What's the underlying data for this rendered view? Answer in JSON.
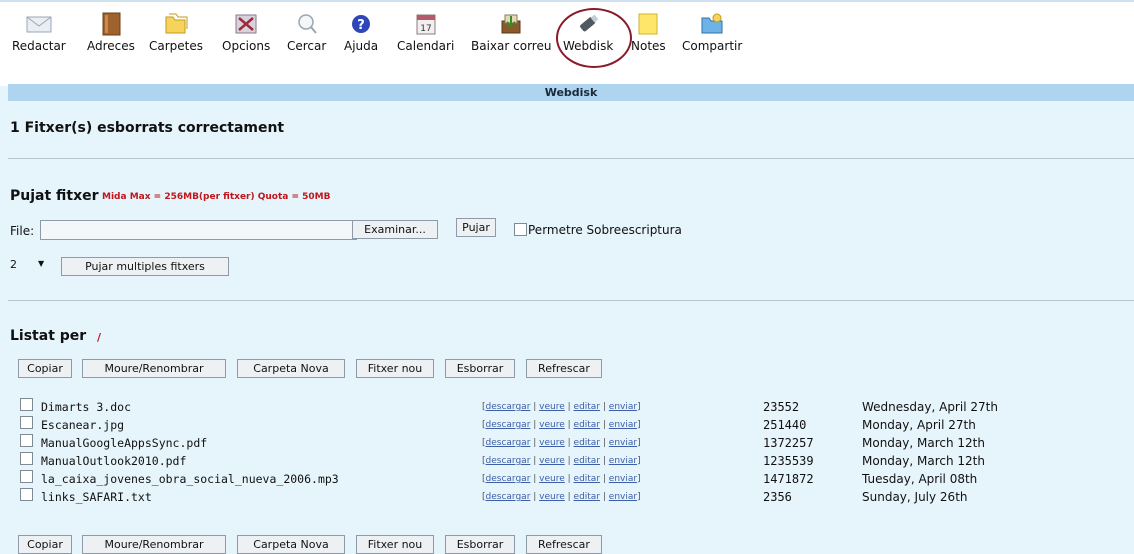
{
  "toolbar": {
    "items": [
      {
        "label": "Redactar",
        "icon": "envelope-icon"
      },
      {
        "label": "Adreces",
        "icon": "address-book-icon"
      },
      {
        "label": "Carpetes",
        "icon": "folders-icon"
      },
      {
        "label": "Opcions",
        "icon": "options-icon"
      },
      {
        "label": "Cercar",
        "icon": "search-icon"
      },
      {
        "label": "Ajuda",
        "icon": "help-icon"
      },
      {
        "label": "Calendari",
        "icon": "calendar-icon"
      },
      {
        "label": "Baixar correu",
        "icon": "download-mail-icon"
      },
      {
        "label": "Webdisk",
        "icon": "usb-drive-icon"
      },
      {
        "label": "Notes",
        "icon": "note-icon"
      },
      {
        "label": "Compartir",
        "icon": "share-icon"
      }
    ],
    "calendar_day": "17"
  },
  "section_title": "Webdisk",
  "status_message": "1 Fitxer(s) esborrats correctament",
  "upload": {
    "title": "Pujat fitxer",
    "meta": "Mida Max = 256MB(per fitxer)   Quota = 50MB",
    "file_label": "File:",
    "file_value": "",
    "browse_label": "Examinar...",
    "upload_label": "Pujar",
    "overwrite_label": "Permetre Sobreescriptura",
    "multi_count": "2",
    "multi_label": "Pujar multiples fitxers"
  },
  "listing": {
    "title": "Listat per",
    "path": "/",
    "buttons": [
      "Copiar",
      "Moure/Renombrar",
      "Carpeta Nova",
      "Fitxer nou",
      "Esborrar",
      "Refrescar"
    ],
    "actions": [
      "descargar",
      "veure",
      "editar",
      "enviar"
    ],
    "files": [
      {
        "name": "Dimarts 3.doc",
        "size": "23552",
        "date": "Wednesday, April 27th"
      },
      {
        "name": "Escanear.jpg",
        "size": "251440",
        "date": "Monday, April 27th"
      },
      {
        "name": "ManualGoogleAppsSync.pdf",
        "size": "1372257",
        "date": "Monday, March 12th"
      },
      {
        "name": "ManualOutlook2010.pdf",
        "size": "1235539",
        "date": "Monday, March 12th"
      },
      {
        "name": "la_caixa_jovenes_obra_social_nueva_2006.mp3",
        "size": "1471872",
        "date": "Tuesday, April 08th"
      },
      {
        "name": "links_SAFARI.txt",
        "size": "2356",
        "date": "Sunday, July 26th"
      }
    ]
  },
  "colors": {
    "accent_red": "#c0161b",
    "header_bar": "#aed4ef",
    "background": "#e6f4fb",
    "highlight_ring": "#8b1a2a"
  }
}
